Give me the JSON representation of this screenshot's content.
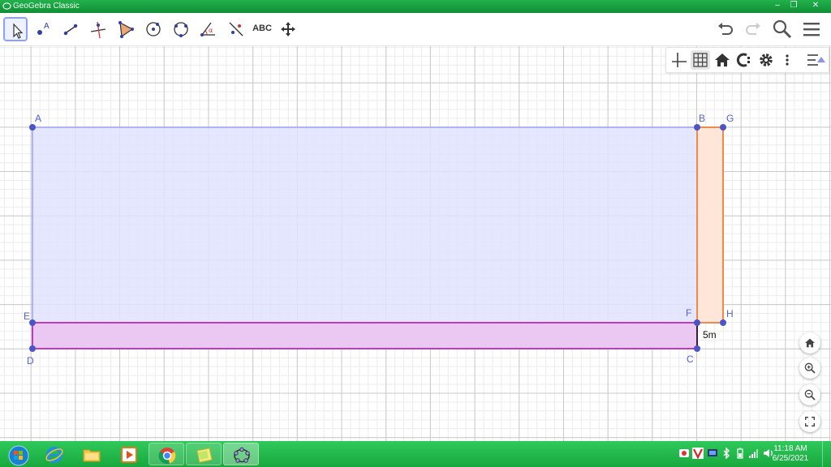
{
  "window": {
    "title": "GeoGebra Classic"
  },
  "toolbar": {
    "tools": [
      {
        "name": "move-tool"
      },
      {
        "name": "point-tool",
        "letter": "A"
      },
      {
        "name": "line-tool"
      },
      {
        "name": "perpendicular-line-tool"
      },
      {
        "name": "polygon-tool"
      },
      {
        "name": "circle-center-tool"
      },
      {
        "name": "circle-three-points-tool"
      },
      {
        "name": "angle-tool",
        "letter": "α"
      },
      {
        "name": "reflect-tool"
      },
      {
        "name": "text-tool",
        "label": "ABC"
      },
      {
        "name": "move-graphics-view-tool"
      }
    ]
  },
  "canvas": {
    "points": {
      "A": "A",
      "B": "B",
      "G": "G",
      "E": "E",
      "F": "F",
      "H": "H",
      "D": "D",
      "C": "C"
    },
    "segment_label": "5m",
    "colors": {
      "big_rect_fill": "#e1e3ff",
      "big_rect_stroke": "#9aa3ef",
      "orange_fill": "#ffe6d8",
      "orange_stroke": "#f08a4b",
      "magenta_fill": "#ebc8f2",
      "magenta_stroke": "#c03ac8",
      "point": "#4a55c8"
    }
  },
  "taskbar": {
    "apps": [
      "start-button",
      "internet-explorer",
      "file-explorer",
      "media-player",
      "chrome",
      "sticky-notes",
      "geogebra"
    ],
    "time": "11:18 AM",
    "date": "6/25/2021"
  }
}
